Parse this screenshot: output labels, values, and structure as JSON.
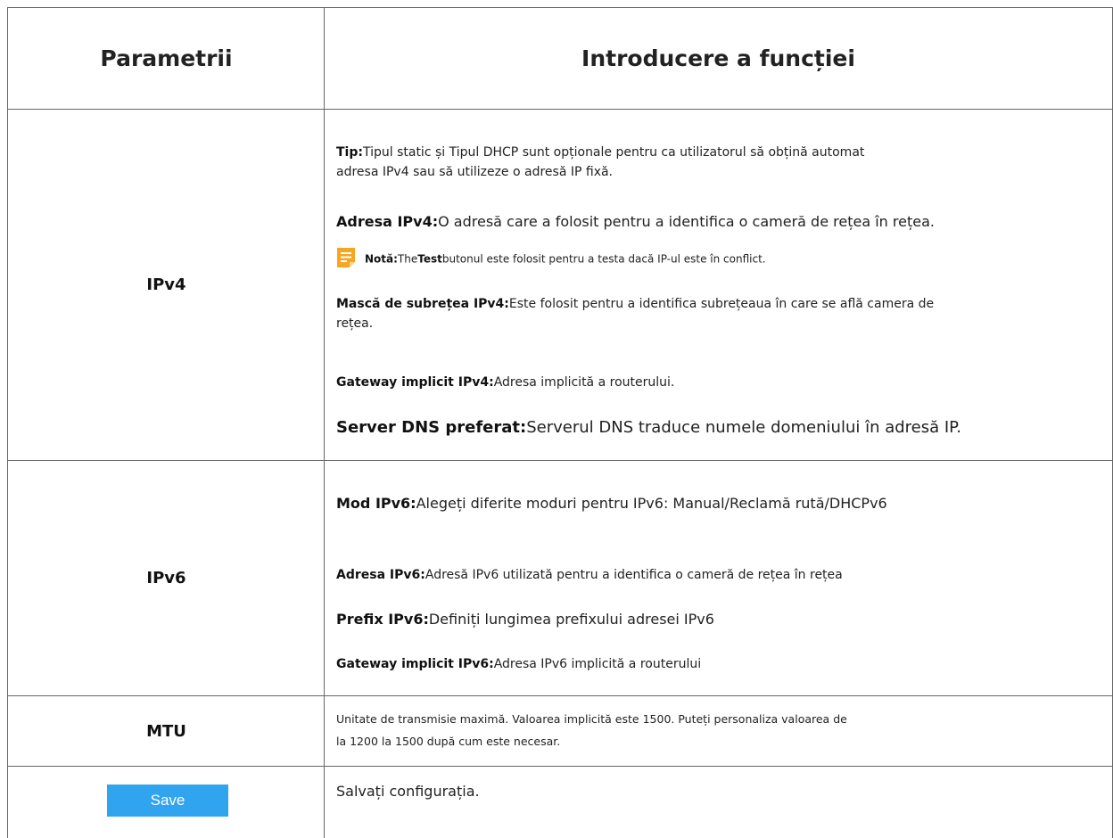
{
  "header": {
    "col_param": "Parametrii",
    "col_desc": "Introducere a funcției"
  },
  "rows": {
    "ipv4": {
      "param": "IPv4",
      "tip_label": "Tip:",
      "tip_text_1": "Tipul static și Tipul DHCP sunt opționale pentru ca utilizatorul să obțină automat",
      "tip_text_2": "adresa IPv4 sau să utilizeze o adresă IP fixă.",
      "addr_label": "Adresa IPv4:",
      "addr_text": "O adresă care a folosit pentru a identifica o cameră de rețea în rețea.",
      "note_label": "Notă:",
      "note_the": "The",
      "note_test": "Test",
      "note_rest": "butonul este folosit pentru a testa dacă IP-ul este în conflict.",
      "mask_label": "Mască de subrețea IPv4:",
      "mask_text_1": "Este folosit pentru a identifica subrețeaua în care se află camera de",
      "mask_text_2": "rețea.",
      "gw_label": "Gateway implicit IPv4:",
      "gw_text": "Adresa implicită a routerului.",
      "dns_label": "Server DNS preferat:",
      "dns_text": "Serverul DNS traduce numele domeniului în adresă IP."
    },
    "ipv6": {
      "param": "IPv6",
      "mode_label": "Mod IPv6:",
      "mode_text": "Alegeți diferite moduri pentru IPv6: Manual/Reclamă rută/DHCPv6",
      "addr_label": "Adresa IPv6:",
      "addr_text": "Adresă IPv6 utilizată pentru a identifica o cameră de rețea în rețea",
      "prefix_label": "Prefix IPv6:",
      "prefix_text": "Definiți lungimea prefixului adresei IPv6",
      "gw_label": "Gateway implicit IPv6:",
      "gw_text": "Adresa IPv6 implicită a routerului"
    },
    "mtu": {
      "param": "MTU",
      "text_1": "Unitate de transmisie maximă. Valoarea implicită este 1500. Puteți personaliza valoarea de",
      "text_2": "la 1200 la 1500 după cum este necesar."
    },
    "save": {
      "button_label": "Save",
      "text": "Salvați configurația."
    }
  },
  "colors": {
    "border": "#666666",
    "button": "#30a4ef",
    "note_icon": "#f5a623"
  },
  "icons": {
    "note": "note-icon"
  }
}
